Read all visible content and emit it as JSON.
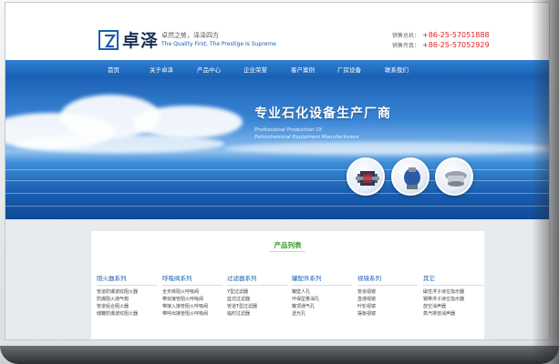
{
  "header": {
    "logo_name": "卓泽",
    "slogan_cn": "卓然之势，泽泽四方",
    "slogan_en": "The Quality First, The Prestige Is Supreme",
    "phone_label": "销售总机：",
    "phone": "+86-25-57051888",
    "fax_label": "销售传真：",
    "fax": "+86-25-57052929"
  },
  "nav": {
    "items": [
      "首页",
      "关于卓泽",
      "产品中心",
      "企业荣誉",
      "客户案例",
      "厂房设备",
      "联系我们"
    ]
  },
  "banner": {
    "title": "专业石化设备生产厂商",
    "sub_line1": "Professional Production Of",
    "sub_line2": "Petrochemical Equipment Manufacturers"
  },
  "products": {
    "title": "产品列表",
    "columns": [
      {
        "head": "阻火器系列",
        "items": [
          "管道防爆波纹阻火器",
          "防爆阻火通气帽",
          "管道铝合阻火器",
          "储罐防爆波纹阻火器"
        ]
      },
      {
        "head": "呼吸阀系列",
        "items": [
          "全天候阻火呼吸阀",
          "带双接管阻火呼吸阀",
          "带接入接管阻火呼吸阀",
          "带呼出接管阻火呼吸阀"
        ]
      },
      {
        "head": "过滤器系列",
        "items": [
          "Y型过滤器",
          "篮式过滤器",
          "管道T型过滤器",
          "临时过滤器"
        ]
      },
      {
        "head": "罐配件系列",
        "items": [
          "罐壁人孔",
          "环保型量油孔",
          "罐顶通气孔",
          "透光孔"
        ]
      },
      {
        "head": "视镜系列",
        "items": [
          "管道视镜",
          "直通视镜",
          "叶轮视镜",
          "摆板视镜"
        ]
      },
      {
        "head": "其它",
        "items": [
          "磁性浮子液位指示器",
          "钢带浮子液位指示器",
          "放空消声器",
          "蒸汽排放消声器"
        ]
      }
    ]
  },
  "colors": {
    "brand_blue": "#1b5fb0",
    "section_green": "#3a9a2f",
    "phone_red": "#dd2222"
  }
}
